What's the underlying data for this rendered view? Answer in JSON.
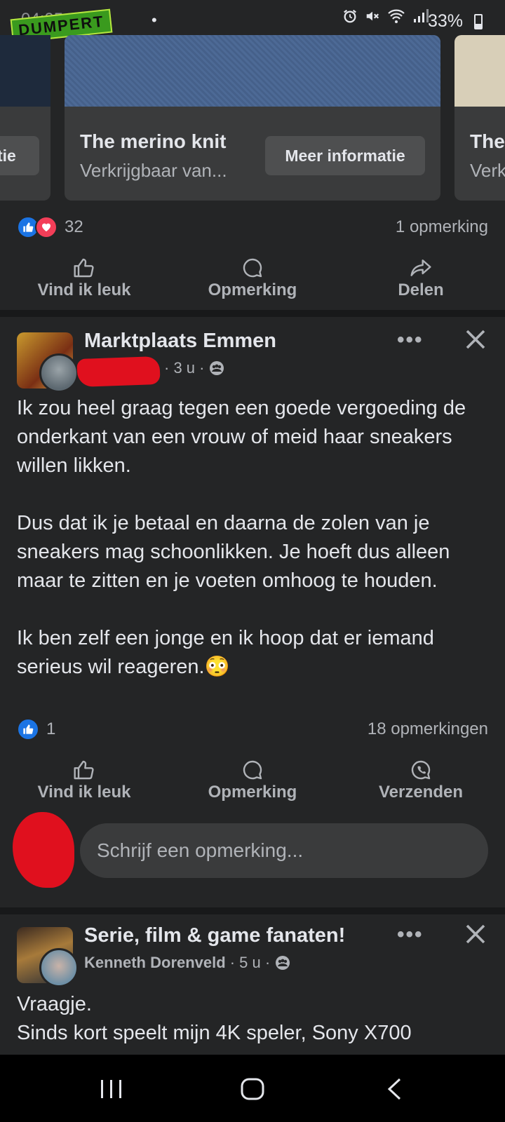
{
  "status_bar": {
    "time": "04:05",
    "watermark": "DUMPERT",
    "dot": "•",
    "battery": "33%",
    "battery_level": 0.33
  },
  "carousel": {
    "left_card_button": "tie",
    "center_card": {
      "title": "The merino knit",
      "subtitle": "Verkrijgbaar van...",
      "button": "Meer informatie"
    },
    "right_card": {
      "title": "The",
      "subtitle": "Verk"
    }
  },
  "ad_post": {
    "reactions_count": "32",
    "comments": "1 opmerking",
    "actions": {
      "like": "Vind ik leuk",
      "comment": "Opmerking",
      "share": "Delen"
    }
  },
  "post1": {
    "group": "Marktplaats Emmen",
    "time": "· 3 u ·",
    "paragraphs": [
      "Ik zou heel graag tegen een goede vergoeding de onderkant van een vrouw of meid haar sneakers willen likken.",
      "Dus dat ik je betaal en daarna de zolen van je sneakers mag schoonlikken. Je hoeft dus alleen maar te zitten en je voeten omhoog te houden.",
      "Ik ben zelf een jonge en ik hoop dat er iemand serieus wil reageren."
    ],
    "emoji": "😳",
    "reactions_count": "1",
    "comments": "18 opmerkingen",
    "actions": {
      "like": "Vind ik leuk",
      "comment": "Opmerking",
      "send": "Verzenden"
    },
    "comment_placeholder": "Schrijf een opmerking..."
  },
  "post2": {
    "group": "Serie, film & game fanaten!",
    "author": "Kenneth Dorenveld",
    "time": "· 5 u ·",
    "text_line1": "Vraagje.",
    "text_line2": "Sinds kort speelt mijn 4K speler, Sony X700"
  },
  "icons": {
    "like": "thumbs-up-icon",
    "comment": "comment-icon",
    "share": "share-icon",
    "send": "whatsapp-icon",
    "close": "close-icon",
    "more": "more-icon",
    "audience": "group-audience-icon"
  },
  "colors": {
    "background": "#242526",
    "card": "#3a3b3c",
    "like_blue": "#1b74e4",
    "love_red": "#f33e58",
    "text_primary": "#e4e6eb",
    "text_secondary": "#b0b3b8",
    "redaction_red": "#e0101e"
  }
}
